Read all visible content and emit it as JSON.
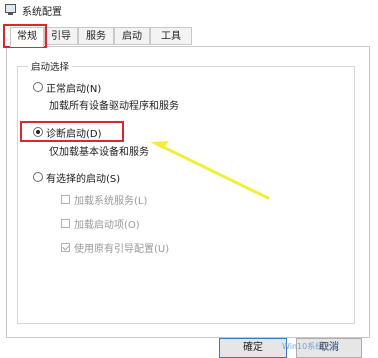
{
  "window": {
    "title": "系统配置",
    "icon": "system-config-icon"
  },
  "tabs": [
    {
      "label": "常规",
      "active": true
    },
    {
      "label": "引导",
      "active": false
    },
    {
      "label": "服务",
      "active": false
    },
    {
      "label": "启动",
      "active": false
    },
    {
      "label": "工具",
      "active": false
    }
  ],
  "startup_group": {
    "legend": "启动选择",
    "options": [
      {
        "label": "正常启动(N)",
        "description": "加载所有设备驱动程序和服务",
        "selected": false
      },
      {
        "label": "诊断启动(D)",
        "description": "仅加载基本设备和服务",
        "selected": true
      },
      {
        "label": "有选择的启动(S)",
        "selected": false
      }
    ],
    "selective_items": [
      {
        "label": "加载系统服务(L)",
        "checked": false,
        "enabled": false
      },
      {
        "label": "加载启动项(O)",
        "checked": false,
        "enabled": false
      },
      {
        "label": "使用原有引导配置(U)",
        "checked": true,
        "enabled": false
      }
    ]
  },
  "buttons": {
    "ok": "確定",
    "cancel": "取消"
  },
  "annotation_colors": {
    "highlight": "#d9292f",
    "arrow": "#f2ef3a"
  },
  "watermark": "Win10系统之家"
}
